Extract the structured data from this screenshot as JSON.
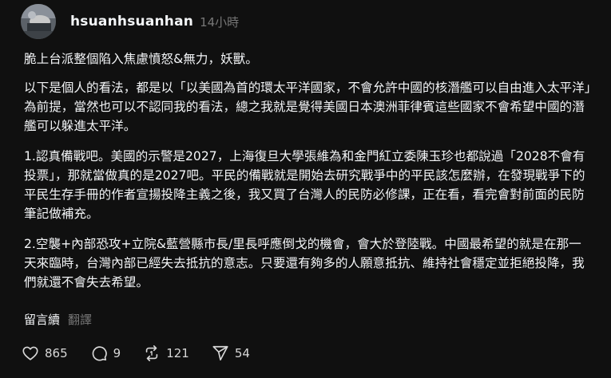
{
  "post": {
    "username": "hsuanhsuanhan",
    "timestamp": "14小時",
    "paragraphs": [
      "脆上台派整個陷入焦慮憤怒&無力，妖獸。",
      "以下是個人的看法，都是以「以美國為首的環太平洋國家，不會允許中國的核潛艦可以自由進入太平洋」為前提，當然也可以不認同我的看法，總之我就是覺得美國日本澳洲菲律賓這些國家不會希望中國的潛艦可以躲進太平洋。",
      "1.認真備戰吧。美國的示警是2027，上海復旦大學張維為和金門紅立委陳玉珍也都說過「2028不會有投票」，那就當做真的是2027吧。平民的備戰就是開始去研究戰爭中的平民該怎麼辦，在發現戰爭下的平民生存手冊的作者宣揚投降主義之後，我又買了台灣人的民防必修課，正在看，看完會對前面的民防筆記做補充。",
      "2.空襲+內部恐攻+立院&藍營縣市長/里長呼應倒戈的機會，會大於登陸戰。中國最希望的就是在那一天來臨時，台灣內部已經失去抵抗的意志。只要還有夠多的人願意抵抗、維持社會穩定並拒絕投降，我們就還不會失去希望。"
    ],
    "continue_label": "留言續",
    "translate_label": "翻譯"
  },
  "actions": {
    "likes": "865",
    "comments": "9",
    "reposts": "121",
    "shares": "54"
  },
  "colors": {
    "background": "#101010",
    "text": "#f3f5f7",
    "muted": "#777777"
  },
  "icons": [
    "avatar",
    "heart-icon",
    "comment-icon",
    "repost-icon",
    "share-icon"
  ]
}
